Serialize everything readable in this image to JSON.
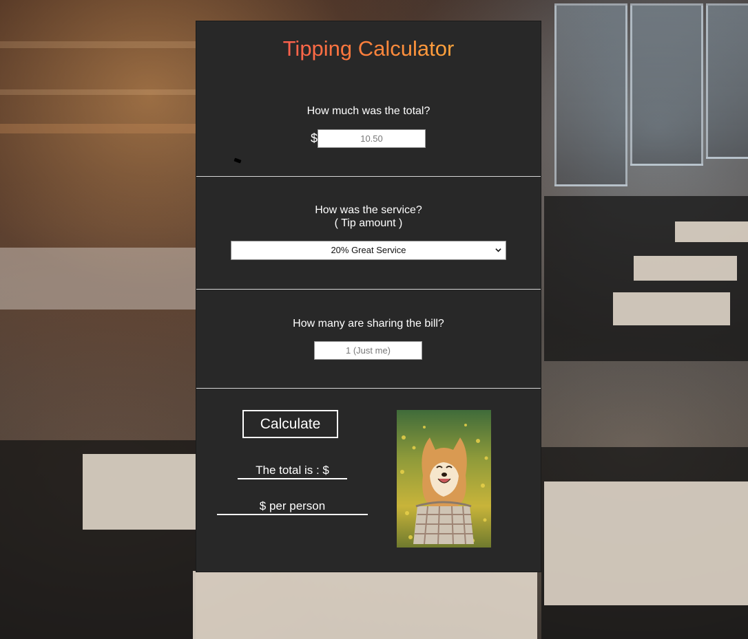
{
  "app": {
    "title": "Tipping Calculator",
    "title_gradient": [
      "#ff3c64",
      "#ff7a3c",
      "#ffc83c"
    ]
  },
  "bill": {
    "question": "How much was the total?",
    "currency_symbol": "$",
    "placeholder": "10.50"
  },
  "service": {
    "question_line1": "How was the service?",
    "question_line2": "( Tip amount )",
    "selected_option": "20% Great Service"
  },
  "people": {
    "question": "How many are sharing the bill?",
    "placeholder": "1 (Just me)"
  },
  "actions": {
    "calculate_label": "Calculate"
  },
  "results": {
    "total_label": "The total is : $",
    "per_person_label": "$ per person"
  },
  "image": {
    "subject": "shiba-inu-dog-in-basket"
  },
  "colors": {
    "panel_bg": "#282828",
    "divider": "#d8d8d8",
    "text": "#ffffff"
  }
}
